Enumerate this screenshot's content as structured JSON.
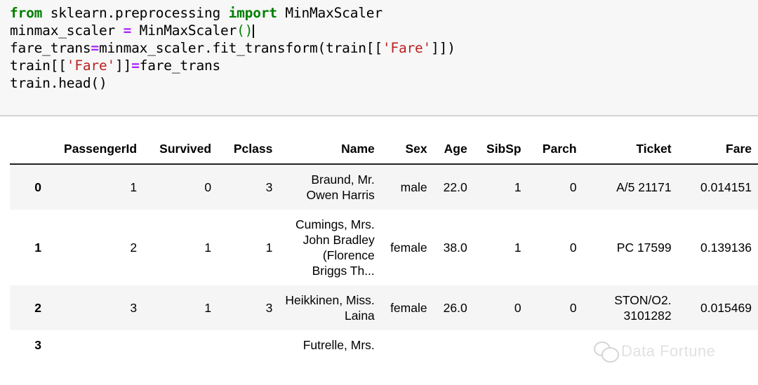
{
  "code_cell": {
    "language": "python",
    "lines": [
      [
        {
          "t": "from",
          "c": "keyword"
        },
        {
          "t": " sklearn.preprocessing ",
          "c": "plain"
        },
        {
          "t": "import",
          "c": "keyword"
        },
        {
          "t": " MinMaxScaler",
          "c": "plain"
        }
      ],
      [
        {
          "t": "minmax_scaler ",
          "c": "plain"
        },
        {
          "t": "=",
          "c": "operator"
        },
        {
          "t": " MinMaxScaler",
          "c": "plain"
        },
        {
          "t": "()",
          "c": "paren"
        },
        {
          "t": "",
          "c": "caret"
        }
      ],
      [
        {
          "t": "fare_trans",
          "c": "plain"
        },
        {
          "t": "=",
          "c": "operator"
        },
        {
          "t": "minmax_scaler.fit_transform(train[[",
          "c": "plain"
        },
        {
          "t": "'Fare'",
          "c": "string"
        },
        {
          "t": "]])",
          "c": "plain"
        }
      ],
      [
        {
          "t": "train[[",
          "c": "plain"
        },
        {
          "t": "'Fare'",
          "c": "string"
        },
        {
          "t": "]]",
          "c": "plain"
        },
        {
          "t": "=",
          "c": "operator"
        },
        {
          "t": "fare_trans",
          "c": "plain"
        }
      ],
      [
        {
          "t": "train.head()",
          "c": "plain"
        }
      ]
    ],
    "colors": {
      "keyword": "#008000",
      "operator": "#aa22ff",
      "string": "#ba2121",
      "paren": "#008000",
      "plain": "#000000",
      "background": "#f7f7f7"
    }
  },
  "dataframe": {
    "index_header": "",
    "columns": [
      "PassengerId",
      "Survived",
      "Pclass",
      "Name",
      "Sex",
      "Age",
      "SibSp",
      "Parch",
      "Ticket",
      "Fare"
    ],
    "rows": [
      {
        "index": "0",
        "PassengerId": "1",
        "Survived": "0",
        "Pclass": "3",
        "Name": "Braund, Mr. Owen Harris",
        "Sex": "male",
        "Age": "22.0",
        "SibSp": "1",
        "Parch": "0",
        "Ticket": "A/5 21171",
        "Fare": "0.014151"
      },
      {
        "index": "1",
        "PassengerId": "2",
        "Survived": "1",
        "Pclass": "1",
        "Name": "Cumings, Mrs. John Bradley (Florence Briggs Th...",
        "Sex": "female",
        "Age": "38.0",
        "SibSp": "1",
        "Parch": "0",
        "Ticket": "PC 17599",
        "Fare": "0.139136"
      },
      {
        "index": "2",
        "PassengerId": "3",
        "Survived": "1",
        "Pclass": "3",
        "Name": "Heikkinen, Miss. Laina",
        "Sex": "female",
        "Age": "26.0",
        "SibSp": "0",
        "Parch": "0",
        "Ticket": "STON/O2. 3101282",
        "Fare": "0.015469"
      },
      {
        "index": "3",
        "PassengerId": "",
        "Survived": "",
        "Pclass": "",
        "Name": "Futrelle, Mrs.",
        "Sex": "",
        "Age": "",
        "SibSp": "",
        "Parch": "",
        "Ticket": "",
        "Fare": ""
      }
    ]
  },
  "watermark": {
    "text": "Data Fortune",
    "logo": "wechat-bubbles-icon",
    "color": "#b9b9b9"
  }
}
